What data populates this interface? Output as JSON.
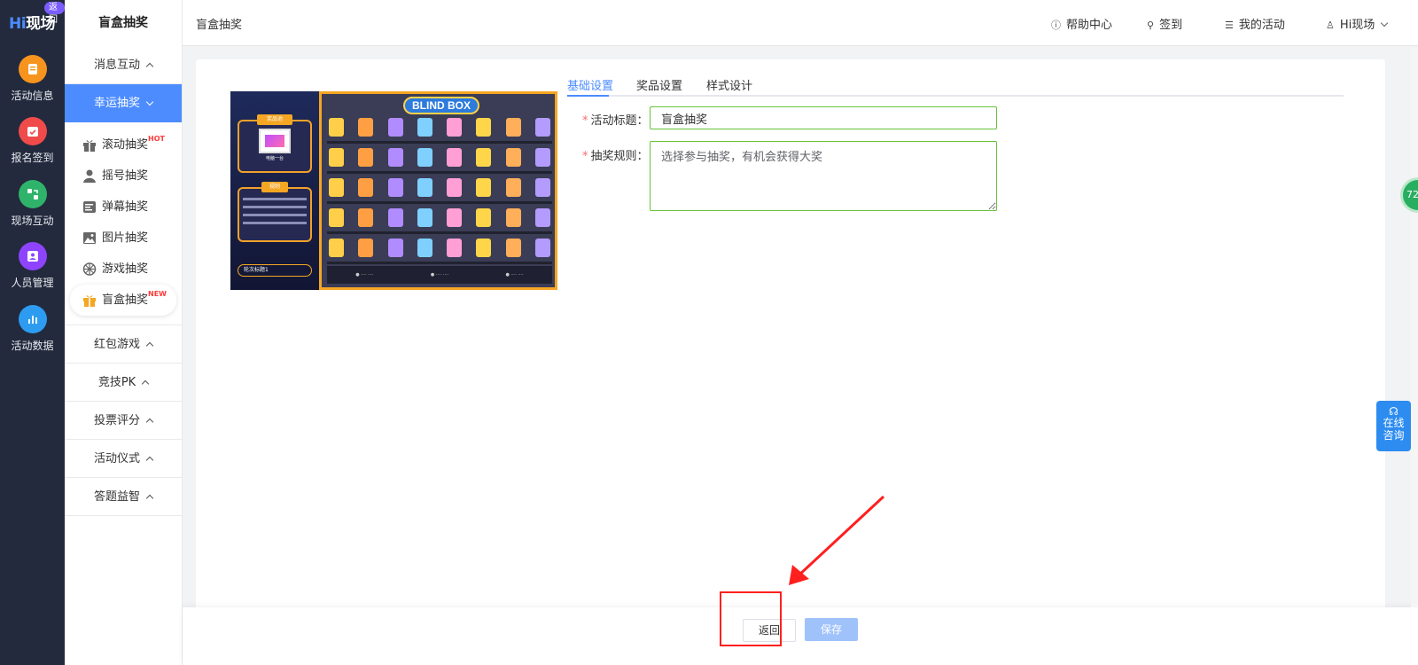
{
  "rail": {
    "logo": "Hi现场",
    "logo_hi": "Hi",
    "logo_rest": "现场",
    "back_badge": "返回",
    "items": [
      {
        "label": "活动信息",
        "icon": "doc-icon",
        "color": "#f7941e"
      },
      {
        "label": "报名签到",
        "icon": "calendar-check-icon",
        "color": "#f04a4a"
      },
      {
        "label": "现场互动",
        "icon": "interact-icon",
        "color": "#2fb36b"
      },
      {
        "label": "人员管理",
        "icon": "person-icon",
        "color": "#8e44ff"
      },
      {
        "label": "活动数据",
        "icon": "bar-chart-icon",
        "color": "#2d9cf0"
      }
    ]
  },
  "sidebar": {
    "title": "盲盒抽奖",
    "groups": [
      {
        "label": "消息互动"
      },
      {
        "label": "幸运抽奖"
      },
      {
        "label": "红包游戏"
      },
      {
        "label": "竞技PK"
      },
      {
        "label": "投票评分"
      },
      {
        "label": "活动仪式"
      },
      {
        "label": "答题益智"
      }
    ],
    "lucky_items": [
      {
        "label": "滚动抽奖",
        "tag": "HOT",
        "icon": "gift-icon"
      },
      {
        "label": "摇号抽奖",
        "tag": "",
        "icon": "user-icon"
      },
      {
        "label": "弹幕抽奖",
        "tag": "",
        "icon": "danmu-icon"
      },
      {
        "label": "图片抽奖",
        "tag": "",
        "icon": "image-icon"
      },
      {
        "label": "游戏抽奖",
        "tag": "",
        "icon": "wheel-icon"
      },
      {
        "label": "盲盒抽奖",
        "tag": "NEW",
        "icon": "blindbox-icon"
      }
    ]
  },
  "header": {
    "breadcrumb": "盲盒抽奖",
    "help": "帮助中心",
    "checkin": "签到",
    "my_activities": "我的活动",
    "user": "Hi现场"
  },
  "preview": {
    "banner": "BLIND BOX",
    "prize_pool": "奖品池",
    "prize_item": "电脑一台",
    "rules_title": "规则",
    "round_select": "轮次标题1"
  },
  "tabs": [
    {
      "label": "基础设置",
      "active": true
    },
    {
      "label": "奖品设置",
      "active": false
    },
    {
      "label": "样式设计",
      "active": false
    }
  ],
  "form": {
    "title_label": "活动标题：",
    "title_value": "盲盒抽奖",
    "rules_label": "抽奖规则：",
    "rules_placeholder": "选择参与抽奖，有机会获得大奖",
    "required_mark": "*"
  },
  "footer": {
    "back": "返回",
    "save": "保存"
  },
  "widgets": {
    "online_consult_line1": "在线",
    "online_consult_line2": "咨询",
    "round_badge": "72"
  },
  "colors": {
    "accent": "#4c8cff",
    "rail_bg": "#232a3d",
    "valid_border": "#67c23a",
    "annotation_red": "#ff1f1f"
  }
}
